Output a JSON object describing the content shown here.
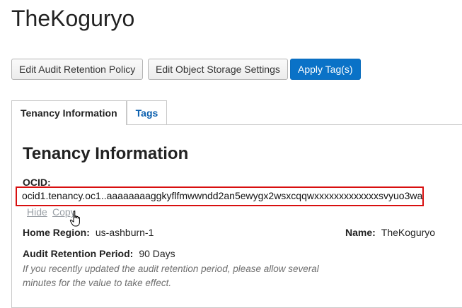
{
  "page": {
    "title": "TheKoguryo"
  },
  "toolbar": {
    "edit_audit_label": "Edit Audit Retention Policy",
    "edit_storage_label": "Edit Object Storage Settings",
    "apply_tags_label": "Apply Tag(s)"
  },
  "tabs": [
    {
      "label": "Tenancy Information",
      "active": true
    },
    {
      "label": "Tags",
      "active": false
    }
  ],
  "tenancy": {
    "section_title": "Tenancy Information",
    "ocid_label": "OCID:",
    "ocid_value": "ocid1.tenancy.oc1..aaaaaaaaggkyflfmwwndd2an5ewygx2wsxcqqwxxxxxxxxxxxxxsvyuo3wa",
    "hide_label": "Hide",
    "copy_label": "Copy",
    "home_region_label": "Home Region:",
    "home_region_value": "us-ashburn-1",
    "name_label": "Name:",
    "name_value": "TheKoguryo",
    "audit_label": "Audit Retention Period:",
    "audit_value": "90 Days",
    "audit_note": "If you recently updated the audit retention period, please allow several minutes for the value to take effect."
  },
  "icons": {
    "cursor": "hand-pointer-icon"
  },
  "colors": {
    "primary": "#0a72c7",
    "highlight_border": "#d80f0f",
    "tab_link": "#0a5fae"
  }
}
